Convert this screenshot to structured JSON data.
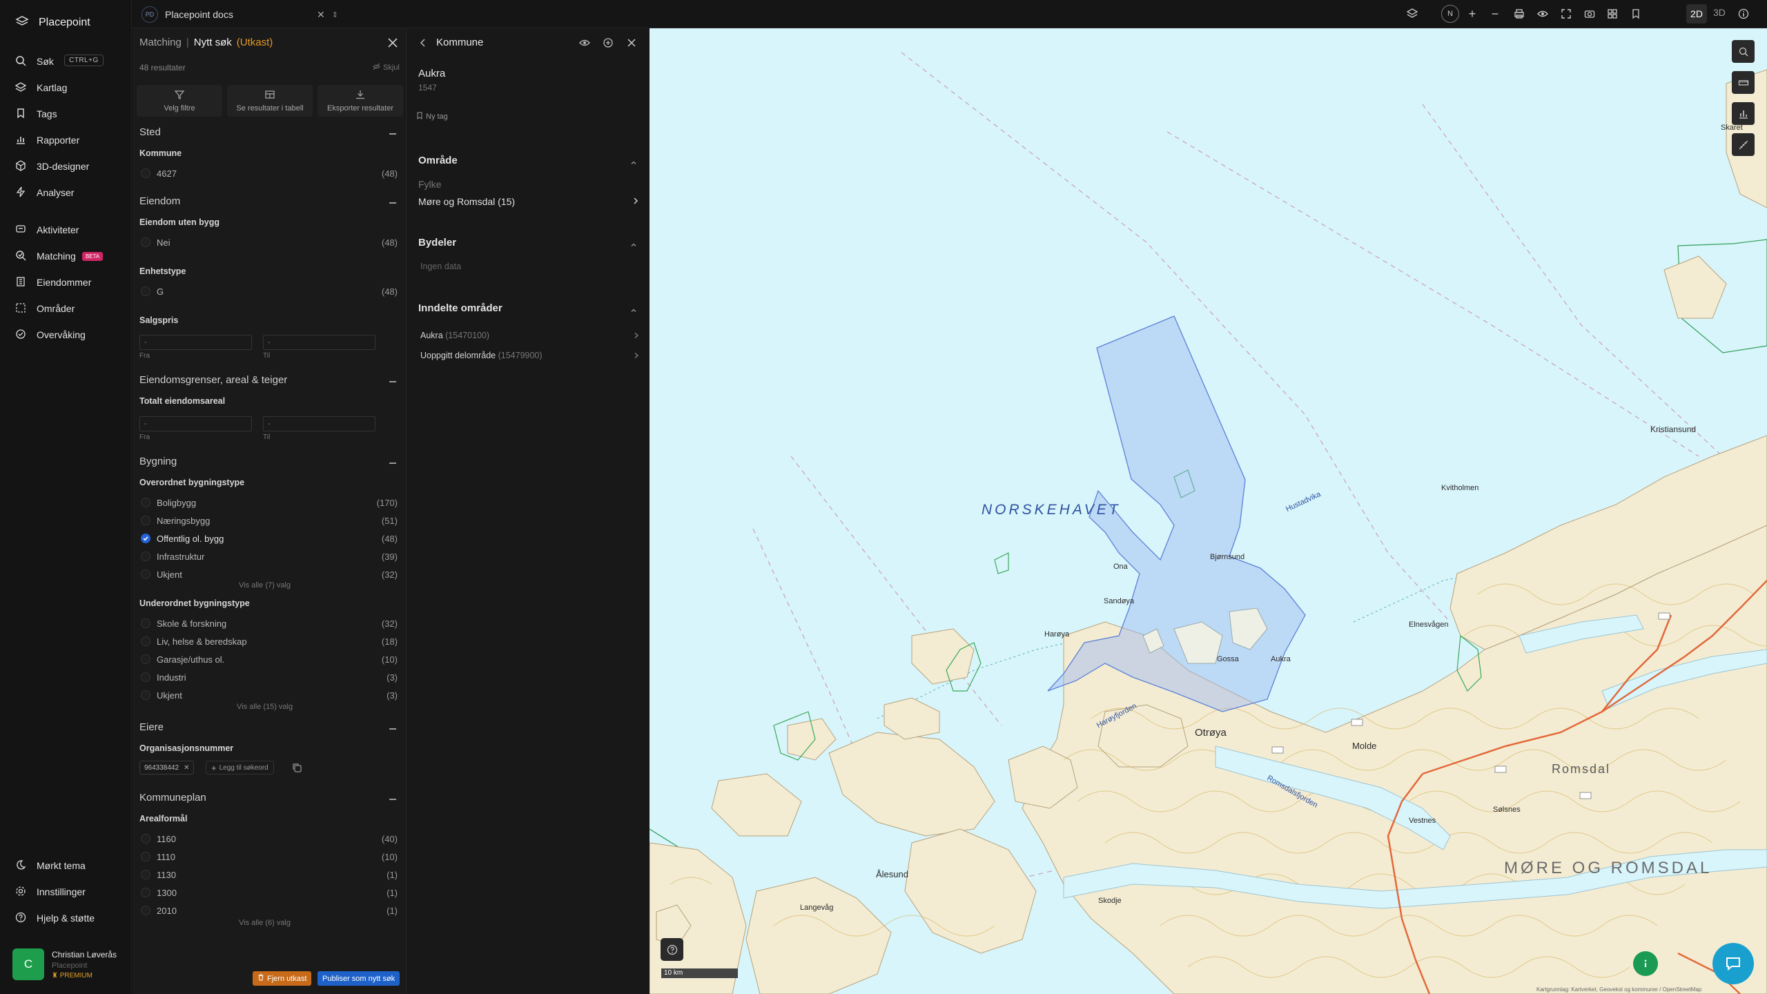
{
  "app": {
    "name": "Placepoint"
  },
  "nav": {
    "search_label": "Søk",
    "search_shortcut": "CTRL+G",
    "items": [
      {
        "label": "Kartlag"
      },
      {
        "label": "Tags"
      },
      {
        "label": "Rapporter"
      },
      {
        "label": "3D-designer"
      },
      {
        "label": "Analyser"
      },
      {
        "label": "Aktiviteter"
      },
      {
        "label": "Matching"
      },
      {
        "label": "Eiendommer"
      },
      {
        "label": "Områder"
      },
      {
        "label": "Overvåking"
      }
    ],
    "beta_badge": "BETA",
    "bottom": [
      {
        "label": "Mørkt tema"
      },
      {
        "label": "Innstillinger"
      },
      {
        "label": "Hjelp & støtte"
      }
    ],
    "user": {
      "initial": "C",
      "name": "Christian Løverås",
      "org": "Placepoint",
      "plan": "PREMIUM"
    }
  },
  "topbar": {
    "workspace_badge": "PD",
    "workspace_name": "Placepoint docs",
    "compass": "N",
    "view_2d": "2D",
    "view_3d": "3D",
    "active_view": "2D"
  },
  "filter": {
    "breadcrumb": "Matching",
    "separator": "|",
    "title": "Nytt søk",
    "status": "(Utkast)",
    "result_count": "48 resultater",
    "hide_label": "Skjul",
    "actions": [
      "Velg filtre",
      "Se resultater i tabell",
      "Eksporter resultater"
    ],
    "sections": {
      "sted": {
        "title": "Sted",
        "kommune_label": "Kommune",
        "kommune": [
          {
            "label": "4627",
            "count": "(48)"
          }
        ]
      },
      "eiendom": {
        "title": "Eiendom",
        "uten_bygg_label": "Eiendom uten bygg",
        "uten_bygg": [
          {
            "label": "Nei",
            "count": "(48)"
          }
        ],
        "enhetstype_label": "Enhetstype",
        "enhetstype": [
          {
            "label": "G",
            "count": "(48)"
          }
        ],
        "salgspris_label": "Salgspris",
        "from_label": "Fra",
        "to_label": "Til",
        "placeholder": "-"
      },
      "grenser": {
        "title": "Eiendomsgrenser, areal & teiger",
        "areal_label": "Totalt eiendomsareal",
        "from_label": "Fra",
        "to_label": "Til",
        "placeholder": "-"
      },
      "bygning": {
        "title": "Bygning",
        "overordnet_label": "Overordnet bygningstype",
        "overordnet": [
          {
            "label": "Boligbygg",
            "count": "(170)",
            "checked": false
          },
          {
            "label": "Næringsbygg",
            "count": "(51)",
            "checked": false
          },
          {
            "label": "Offentlig ol. bygg",
            "count": "(48)",
            "checked": true
          },
          {
            "label": "Infrastruktur",
            "count": "(39)",
            "checked": false
          },
          {
            "label": "Ukjent",
            "count": "(32)",
            "checked": false
          }
        ],
        "overordnet_showall": "Vis alle (7) valg",
        "underordnet_label": "Underordnet bygningstype",
        "underordnet": [
          {
            "label": "Skole & forskning",
            "count": "(32)"
          },
          {
            "label": "Liv, helse & beredskap",
            "count": "(18)"
          },
          {
            "label": "Garasje/uthus ol.",
            "count": "(10)"
          },
          {
            "label": "Industri",
            "count": "(3)"
          },
          {
            "label": "Ukjent",
            "count": "(3)"
          }
        ],
        "underordnet_showall": "Vis alle (15) valg"
      },
      "eiere": {
        "title": "Eiere",
        "org_label": "Organisasjonsnummer",
        "chip": "964338442",
        "add_keyword": "Legg til søkeord"
      },
      "kommuneplan": {
        "title": "Kommuneplan",
        "arealformal_label": "Arealformål",
        "arealformal": [
          {
            "label": "1160",
            "count": "(40)"
          },
          {
            "label": "1110",
            "count": "(10)"
          },
          {
            "label": "1130",
            "count": "(1)"
          },
          {
            "label": "1300",
            "count": "(1)"
          },
          {
            "label": "2010",
            "count": "(1)"
          }
        ],
        "showall": "Vis alle (6) valg"
      }
    },
    "remove_draft": "Fjern utkast",
    "publish": "Publiser som nytt søk"
  },
  "detail": {
    "title": "Kommune",
    "name": "Aukra",
    "number": "1547",
    "new_tag": "Ny tag",
    "omrade_title": "Område",
    "fylke_label": "Fylke",
    "fylke_value": "Møre og Romsdal (15)",
    "bydeler_title": "Bydeler",
    "bydeler_empty": "Ingen data",
    "inndelte_title": "Inndelte områder",
    "inndelte": [
      {
        "name": "Aukra",
        "code": "(15470100)"
      },
      {
        "name": "Uoppgitt delområde",
        "code": "(15479900)"
      }
    ]
  },
  "map": {
    "sea_label": "NORSKEHAVET",
    "region_label": "MØRE OG ROMSDAL",
    "romsdal_label": "Romsdal",
    "places": [
      {
        "name": "Otrøya"
      },
      {
        "name": "Molde"
      },
      {
        "name": "Aukra"
      },
      {
        "name": "Gossa"
      },
      {
        "name": "Bjørnsund"
      },
      {
        "name": "Ona"
      },
      {
        "name": "Sandøya"
      },
      {
        "name": "Harøya"
      },
      {
        "name": "Ålesund"
      },
      {
        "name": "Vestnes"
      },
      {
        "name": "Hustadvika"
      },
      {
        "name": "Kristiansund"
      },
      {
        "name": "Harøyfjorden"
      },
      {
        "name": "Romsdalsfjorden"
      },
      {
        "name": "Skaret"
      },
      {
        "name": "Kvitholmen"
      },
      {
        "name": "Elnesvågen"
      },
      {
        "name": "Sølsnes"
      },
      {
        "name": "Skodje"
      },
      {
        "name": "Langevåg"
      }
    ],
    "scale": "10 km",
    "attribution": "Kartgrunnlag: Kartverket, Geovekst og kommuner / OpenStreetMap"
  },
  "colors": {
    "accent": "#2563d9",
    "draft": "#e19a25",
    "beta": "#d12565",
    "ocean": "#d8f5fb",
    "land": "#f3ecd3",
    "selection": "#9bb8f0"
  }
}
